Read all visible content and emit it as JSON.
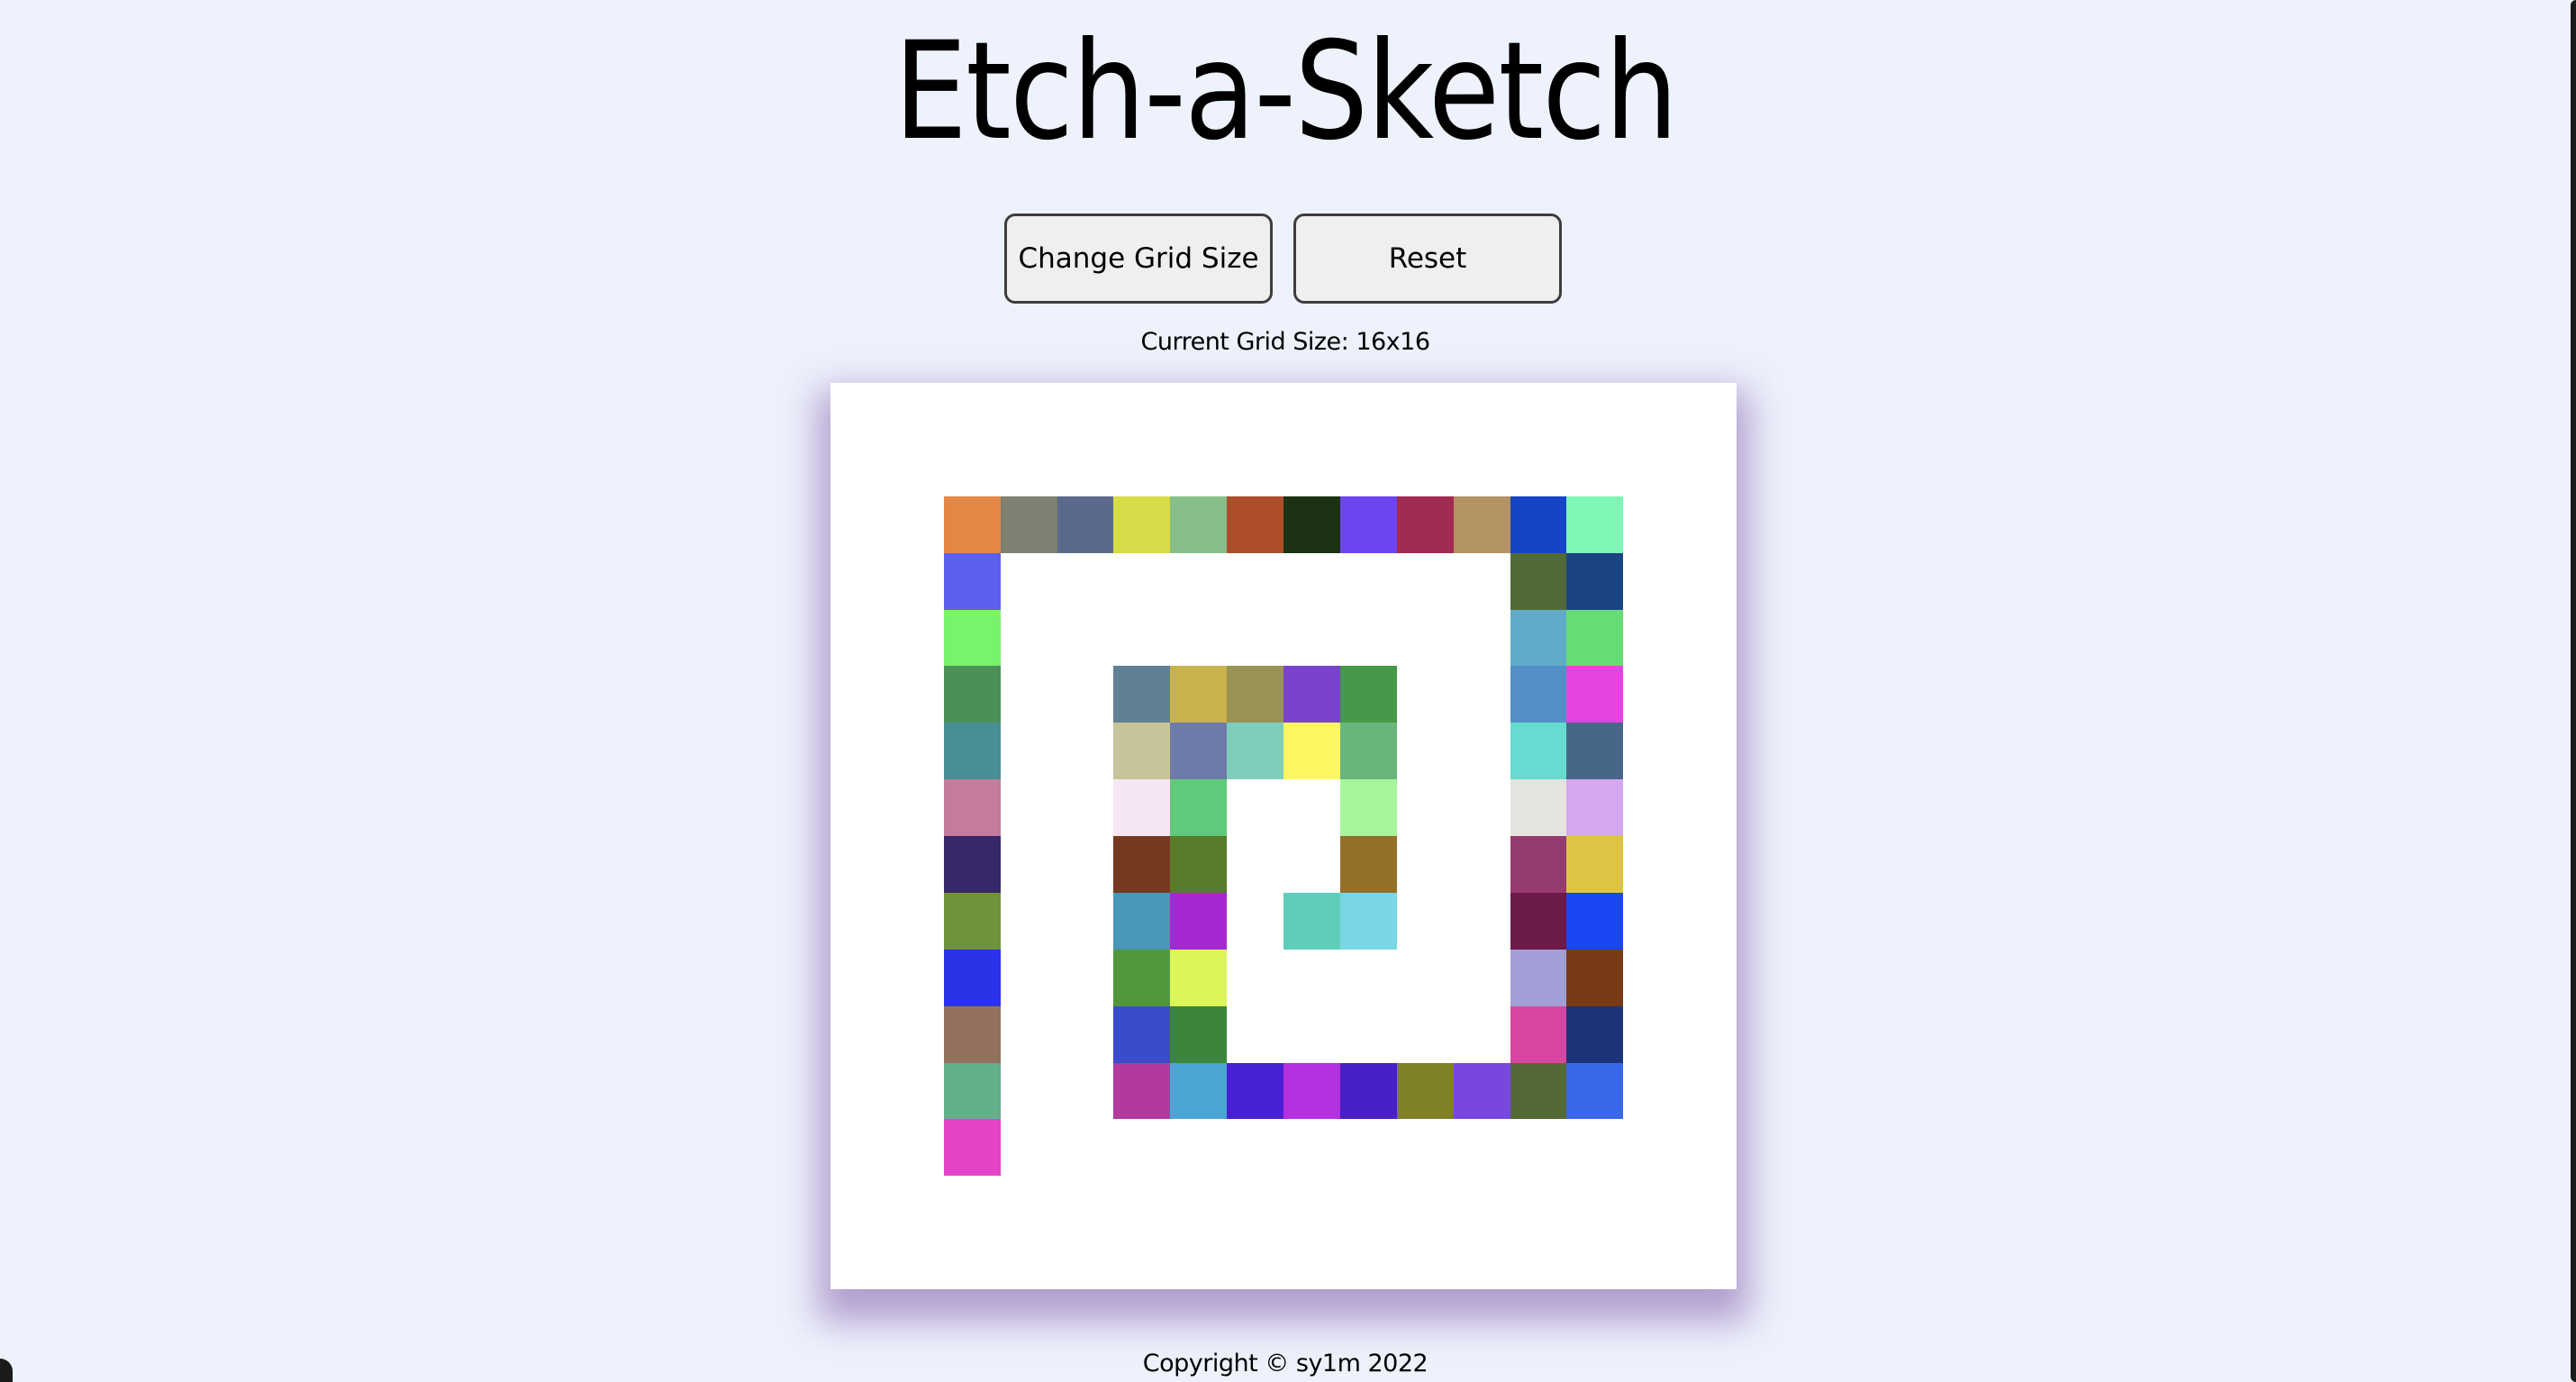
{
  "header": {
    "title": "Etch-a-Sketch"
  },
  "controls": {
    "change_grid_label": "Change Grid Size",
    "reset_label": "Reset"
  },
  "status": {
    "grid_size_text": "Current Grid Size: 16x16"
  },
  "footer": {
    "copyright": "Copyright © sy1m 2022"
  },
  "grid": {
    "size": 16,
    "background": "#ffffff",
    "painted": [
      [
        2,
        2,
        "#e48744"
      ],
      [
        2,
        3,
        "#7f7f72"
      ],
      [
        2,
        4,
        "#5b6a8c"
      ],
      [
        2,
        5,
        "#d6dc48"
      ],
      [
        2,
        6,
        "#87bf8a"
      ],
      [
        2,
        7,
        "#ad4e2b"
      ],
      [
        2,
        8,
        "#1b3214"
      ],
      [
        2,
        9,
        "#6c45ee"
      ],
      [
        2,
        10,
        "#a22b53"
      ],
      [
        2,
        11,
        "#b39263"
      ],
      [
        2,
        12,
        "#1644c6"
      ],
      [
        2,
        13,
        "#7ef6b6"
      ],
      [
        3,
        2,
        "#5d5fee"
      ],
      [
        3,
        12,
        "#526a37"
      ],
      [
        3,
        13,
        "#1b4483"
      ],
      [
        4,
        2,
        "#79f26c"
      ],
      [
        4,
        12,
        "#60acc8"
      ],
      [
        4,
        13,
        "#67dc74"
      ],
      [
        5,
        2,
        "#4c9059"
      ],
      [
        5,
        5,
        "#608194"
      ],
      [
        5,
        6,
        "#c8b24c"
      ],
      [
        5,
        7,
        "#999356"
      ],
      [
        5,
        8,
        "#7944cb"
      ],
      [
        5,
        9,
        "#459948"
      ],
      [
        5,
        12,
        "#538fc7"
      ],
      [
        5,
        13,
        "#e643e2"
      ],
      [
        6,
        2,
        "#468f94"
      ],
      [
        6,
        5,
        "#c7c39a"
      ],
      [
        6,
        6,
        "#6e7ba8"
      ],
      [
        6,
        7,
        "#7fcebc"
      ],
      [
        6,
        8,
        "#fcf661"
      ],
      [
        6,
        9,
        "#69b67d"
      ],
      [
        6,
        12,
        "#65dccf"
      ],
      [
        6,
        13,
        "#476789"
      ],
      [
        7,
        2,
        "#c57b9b"
      ],
      [
        7,
        5,
        "#f6e6f3"
      ],
      [
        7,
        6,
        "#60c97b"
      ],
      [
        7,
        9,
        "#a6f59c"
      ],
      [
        7,
        12,
        "#e3e4de"
      ],
      [
        7,
        13,
        "#d3a8ef"
      ],
      [
        8,
        2,
        "#37286a"
      ],
      [
        8,
        5,
        "#763a20"
      ],
      [
        8,
        6,
        "#587c29"
      ],
      [
        8,
        9,
        "#936f28"
      ],
      [
        8,
        12,
        "#953b70"
      ],
      [
        8,
        13,
        "#ddc444"
      ],
      [
        9,
        2,
        "#6f933b"
      ],
      [
        9,
        5,
        "#4897b7"
      ],
      [
        9,
        6,
        "#a528d2"
      ],
      [
        9,
        8,
        "#60cdb9"
      ],
      [
        9,
        9,
        "#7ad6e6"
      ],
      [
        9,
        12,
        "#6c1a47"
      ],
      [
        9,
        13,
        "#1847f3"
      ],
      [
        10,
        2,
        "#2a33e8"
      ],
      [
        10,
        5,
        "#52983a"
      ],
      [
        10,
        6,
        "#dcf659"
      ],
      [
        10,
        12,
        "#a29fd6"
      ],
      [
        10,
        13,
        "#783b18"
      ],
      [
        11,
        2,
        "#956f5d"
      ],
      [
        11,
        5,
        "#3b4ccb"
      ],
      [
        11,
        6,
        "#3e853c"
      ],
      [
        11,
        12,
        "#d746a2"
      ],
      [
        11,
        13,
        "#1c3479"
      ],
      [
        12,
        2,
        "#61b08a"
      ],
      [
        12,
        5,
        "#b3399d"
      ],
      [
        12,
        6,
        "#4aa5d3"
      ],
      [
        12,
        7,
        "#4720d4"
      ],
      [
        12,
        8,
        "#b331df"
      ],
      [
        12,
        9,
        "#4820c6"
      ],
      [
        12,
        10,
        "#7f8028"
      ],
      [
        12,
        11,
        "#7847e1"
      ],
      [
        12,
        12,
        "#536a37"
      ],
      [
        12,
        13,
        "#3b67ea"
      ],
      [
        13,
        2,
        "#e443c8"
      ]
    ]
  }
}
